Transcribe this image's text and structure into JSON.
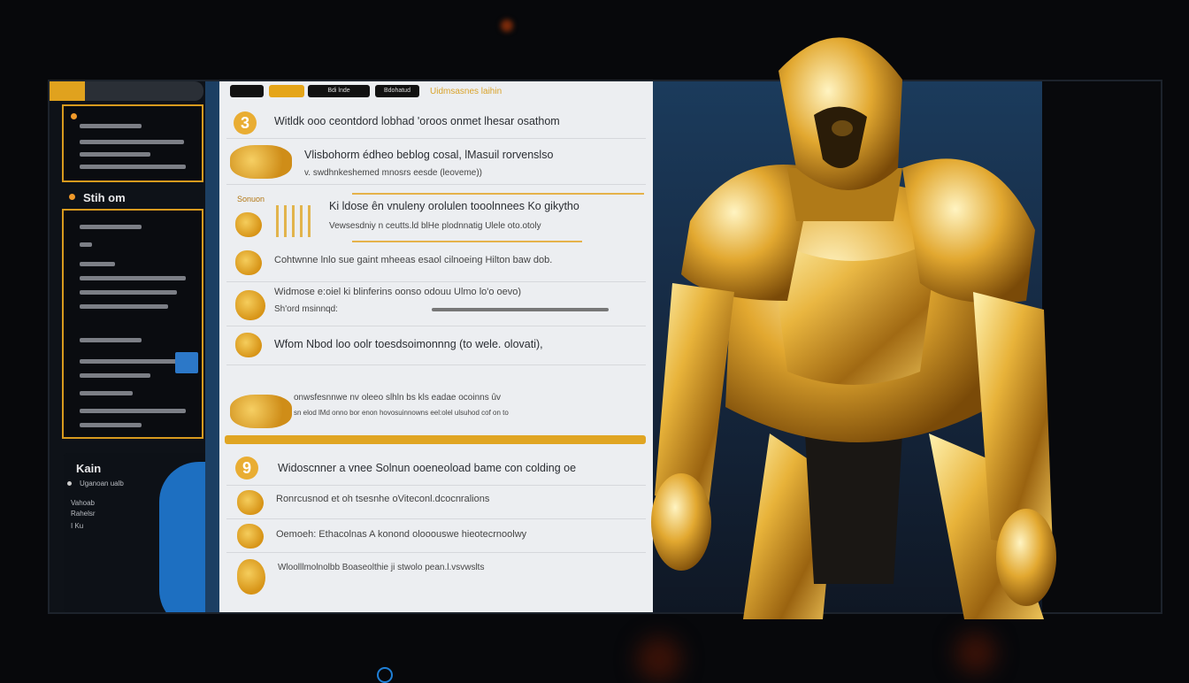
{
  "colors": {
    "accent": "#e0a21e",
    "panel": "#eceef1",
    "blue": "#1d6fc1",
    "dark": "#07080b"
  },
  "toolbar": {
    "pill_1": "",
    "pill_2": "",
    "pill_3": "Bdi lnde",
    "pill_4": "Bdohatud",
    "title": "Uidmsasnes laihin"
  },
  "sidebar": {
    "section_label": "Stih om",
    "bottom_label": "Kain",
    "bottom_sub": "Uganoan ualb",
    "bottom_line_1": "Vahoab",
    "bottom_line_2": "Rahelsr",
    "bottom_line_3": "I Ku"
  },
  "rows": [
    {
      "icon": "3",
      "line1": "Witldk ooo ceontdord lobhad 'oroos onmet lhesar osathom",
      "line2": ""
    },
    {
      "icon": "blob",
      "line1": "Vlisbohorm édheo beblog cosal, lMasuil rorvenslso",
      "line2": "v. swdhnkeshemed mnosrs eesde (leoveme))"
    },
    {
      "icon": "Sonuon",
      "line1": "Ki ldose ên vnuleny orolulen tooolnnees Ko gikytho",
      "line2": "Vewsesdniy n ceutts.ld blHe plodnnatig Ulele oto.otoly"
    },
    {
      "icon": "blob",
      "line1": "Cohtwnne lnlo sue gaint mheeas esaol cilnoeing Hilton baw dob.",
      "line2": ""
    },
    {
      "icon": "blob",
      "line1": "Widmose e:oiel ki blinferins oonso odouu Ulmo lo'o oevo)",
      "line2": "Sh'ord msinnqd:"
    },
    {
      "icon": "blob",
      "line1": "Wfom Nbod loo oolr toesdsoimonnng (to wele. olovati),",
      "line2": ""
    },
    {
      "icon": "cluster",
      "line1": "onwsfesnnwe nv oleeo slhln bs kls eadae ocoinns ûv",
      "line2": "sn elod lMd onno bor enon hovosuinnowns eel:olel ulsuhod cof on to"
    },
    {
      "icon": "9",
      "line1": "Widoscnner a vnee Solnun ooeneoload bame con colding oe",
      "line2": ""
    },
    {
      "icon": "blob",
      "line1": "Ronrcusnod et oh tsesnhe oViteconl.dcocnralions",
      "line2": ""
    },
    {
      "icon": "blob",
      "line1": "Oemoeh: Ethacolnas A konond olooouswe hieotecrnoolwy",
      "line2": ""
    },
    {
      "icon": "blob",
      "line1": "Wloolllmolnolbb Boaseolthie ji stwolo pean.l.vsvwslts",
      "line2": ""
    }
  ]
}
